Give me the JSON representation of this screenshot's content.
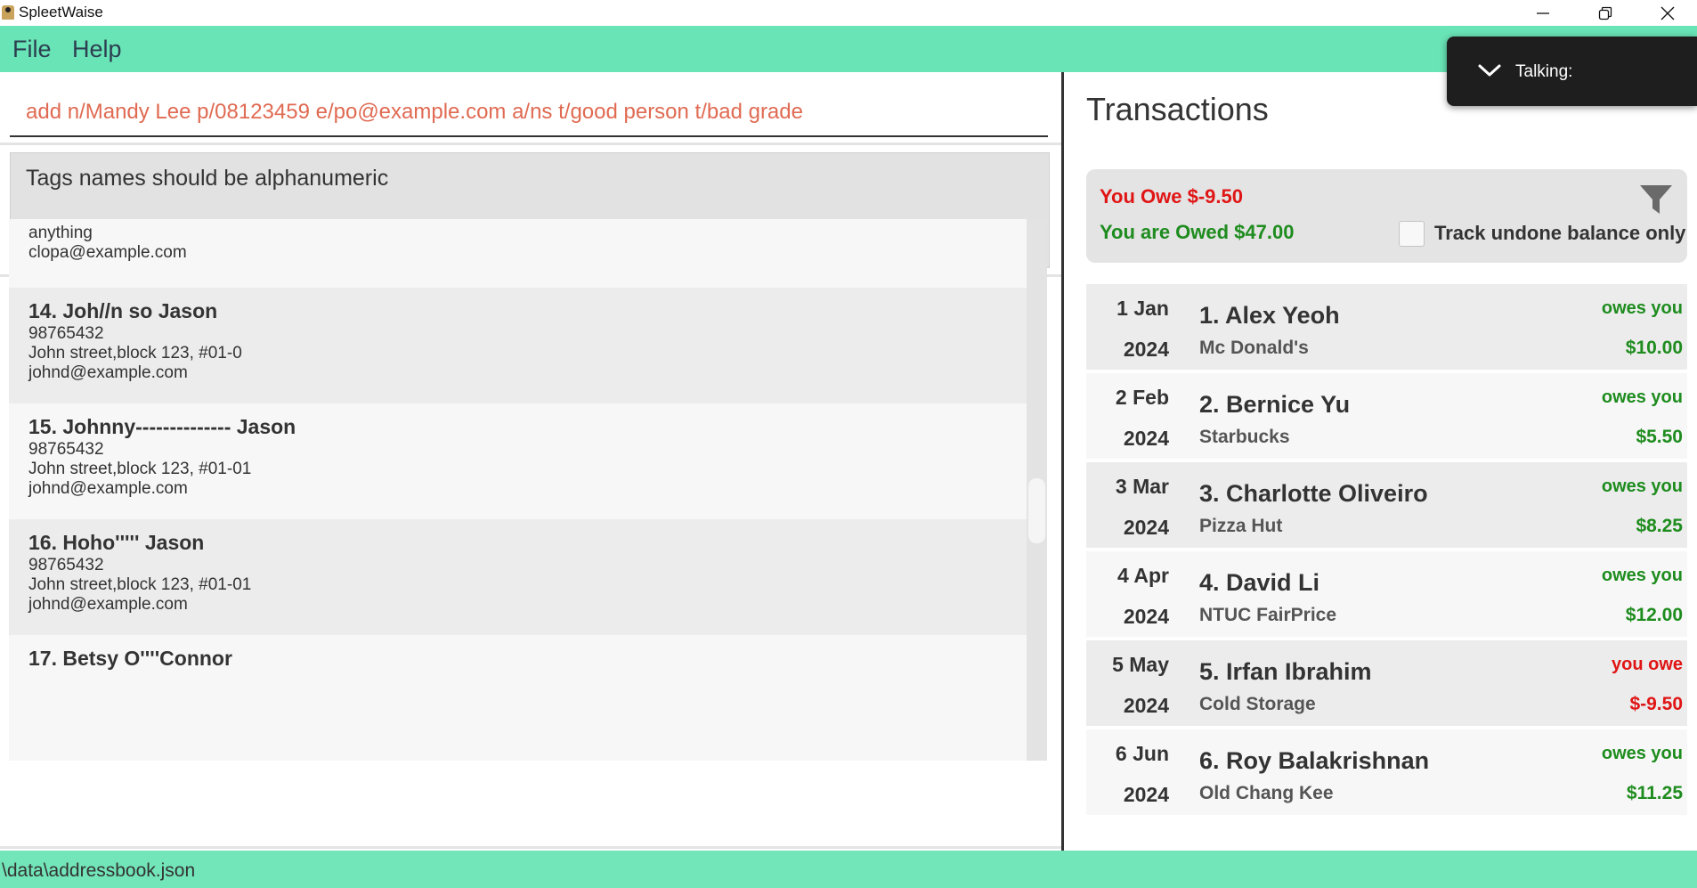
{
  "window": {
    "title": "SpleetWaise"
  },
  "menu": {
    "file": "File",
    "help": "Help"
  },
  "command": {
    "value": "add n/Mandy Lee p/08123459 e/po@example.com a/ns t/good person t/bad grade"
  },
  "result": {
    "message": "Tags names should be alphanumeric"
  },
  "persons": [
    {
      "name": "",
      "tags": "anything",
      "phone": "",
      "address": "",
      "email": "clopa@example.com"
    },
    {
      "name": "14. Joh//n so Jason",
      "phone": "98765432",
      "address": "John street,block 123, #01-0",
      "email": "johnd@example.com"
    },
    {
      "name": "15. Johnny-------------- Jason",
      "phone": "98765432",
      "address": "John street,block 123, #01-01",
      "email": "johnd@example.com"
    },
    {
      "name": "16. Hoho''''' Jason",
      "phone": "98765432",
      "address": "John street,block 123, #01-01",
      "email": "johnd@example.com"
    },
    {
      "name": "17. Betsy O''''Connor"
    }
  ],
  "transactions_panel": {
    "title": "Transactions",
    "you_owe": "You Owe $-9.50",
    "you_are_owed": "You are Owed $47.00",
    "track_label": "Track undone balance only",
    "track_checked": false,
    "icons": {
      "filter": "filter-icon"
    }
  },
  "transactions": [
    {
      "date": "1 Jan",
      "year": "2024",
      "name": "1. Alex Yeoh",
      "desc": "Mc Donald's",
      "status": "owes you",
      "amount": "$10.00",
      "kind": "owed"
    },
    {
      "date": "2 Feb",
      "year": "2024",
      "name": "2. Bernice Yu",
      "desc": "Starbucks",
      "status": "owes you",
      "amount": "$5.50",
      "kind": "owed"
    },
    {
      "date": "3 Mar",
      "year": "2024",
      "name": "3. Charlotte Oliveiro",
      "desc": "Pizza Hut",
      "status": "owes you",
      "amount": "$8.25",
      "kind": "owed"
    },
    {
      "date": "4 Apr",
      "year": "2024",
      "name": "4. David Li",
      "desc": "NTUC FairPrice",
      "status": "owes you",
      "amount": "$12.00",
      "kind": "owed"
    },
    {
      "date": "5 May",
      "year": "2024",
      "name": "5. Irfan Ibrahim",
      "desc": "Cold Storage",
      "status": "you owe",
      "amount": "$-9.50",
      "kind": "owe"
    },
    {
      "date": "6 Jun",
      "year": "2024",
      "name": "6. Roy Balakrishnan",
      "desc": "Old Chang Kee",
      "status": "owes you",
      "amount": "$11.25",
      "kind": "owed"
    }
  ],
  "status_bar": {
    "path": "\\data\\addressbook.json"
  },
  "overlay": {
    "talking": "Talking:"
  },
  "colors": {
    "accent": "#69e4b6",
    "owe": "#e01515",
    "owed": "#1e8c1e",
    "command_text": "#e06a52"
  }
}
